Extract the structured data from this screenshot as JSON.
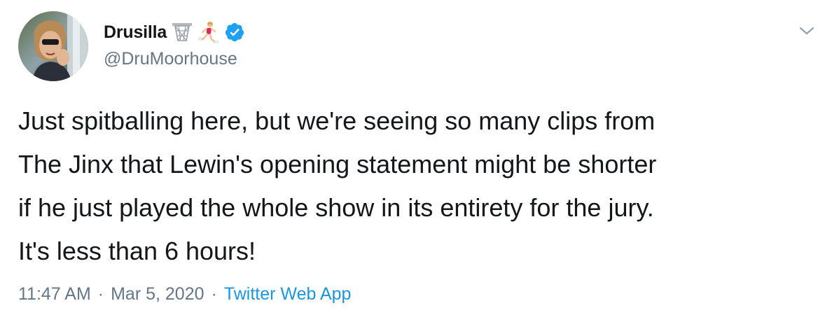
{
  "tweet": {
    "author": {
      "display_name": "Drusilla",
      "handle": "@DruMoorhouse",
      "badges": [
        "basketball-hoop-emoji",
        "woman-running-emoji",
        "verified-badge"
      ],
      "avatar_icon": "profile-photo"
    },
    "text": "Just spitballing here, but we're seeing so many clips from\nThe Jinx that Lewin's opening statement might be shorter\nif he just played the whole show in its entirety for the jury.\nIt's less than 6 hours!",
    "time": "11:47 AM",
    "separator": "·",
    "date": "Mar 5, 2020",
    "source": "Twitter Web App",
    "menu_icon": "chevron-down-icon"
  },
  "colors": {
    "text": "#14171a",
    "secondary": "#657786",
    "link": "#1b95e0",
    "verified": "#1da1f2"
  }
}
